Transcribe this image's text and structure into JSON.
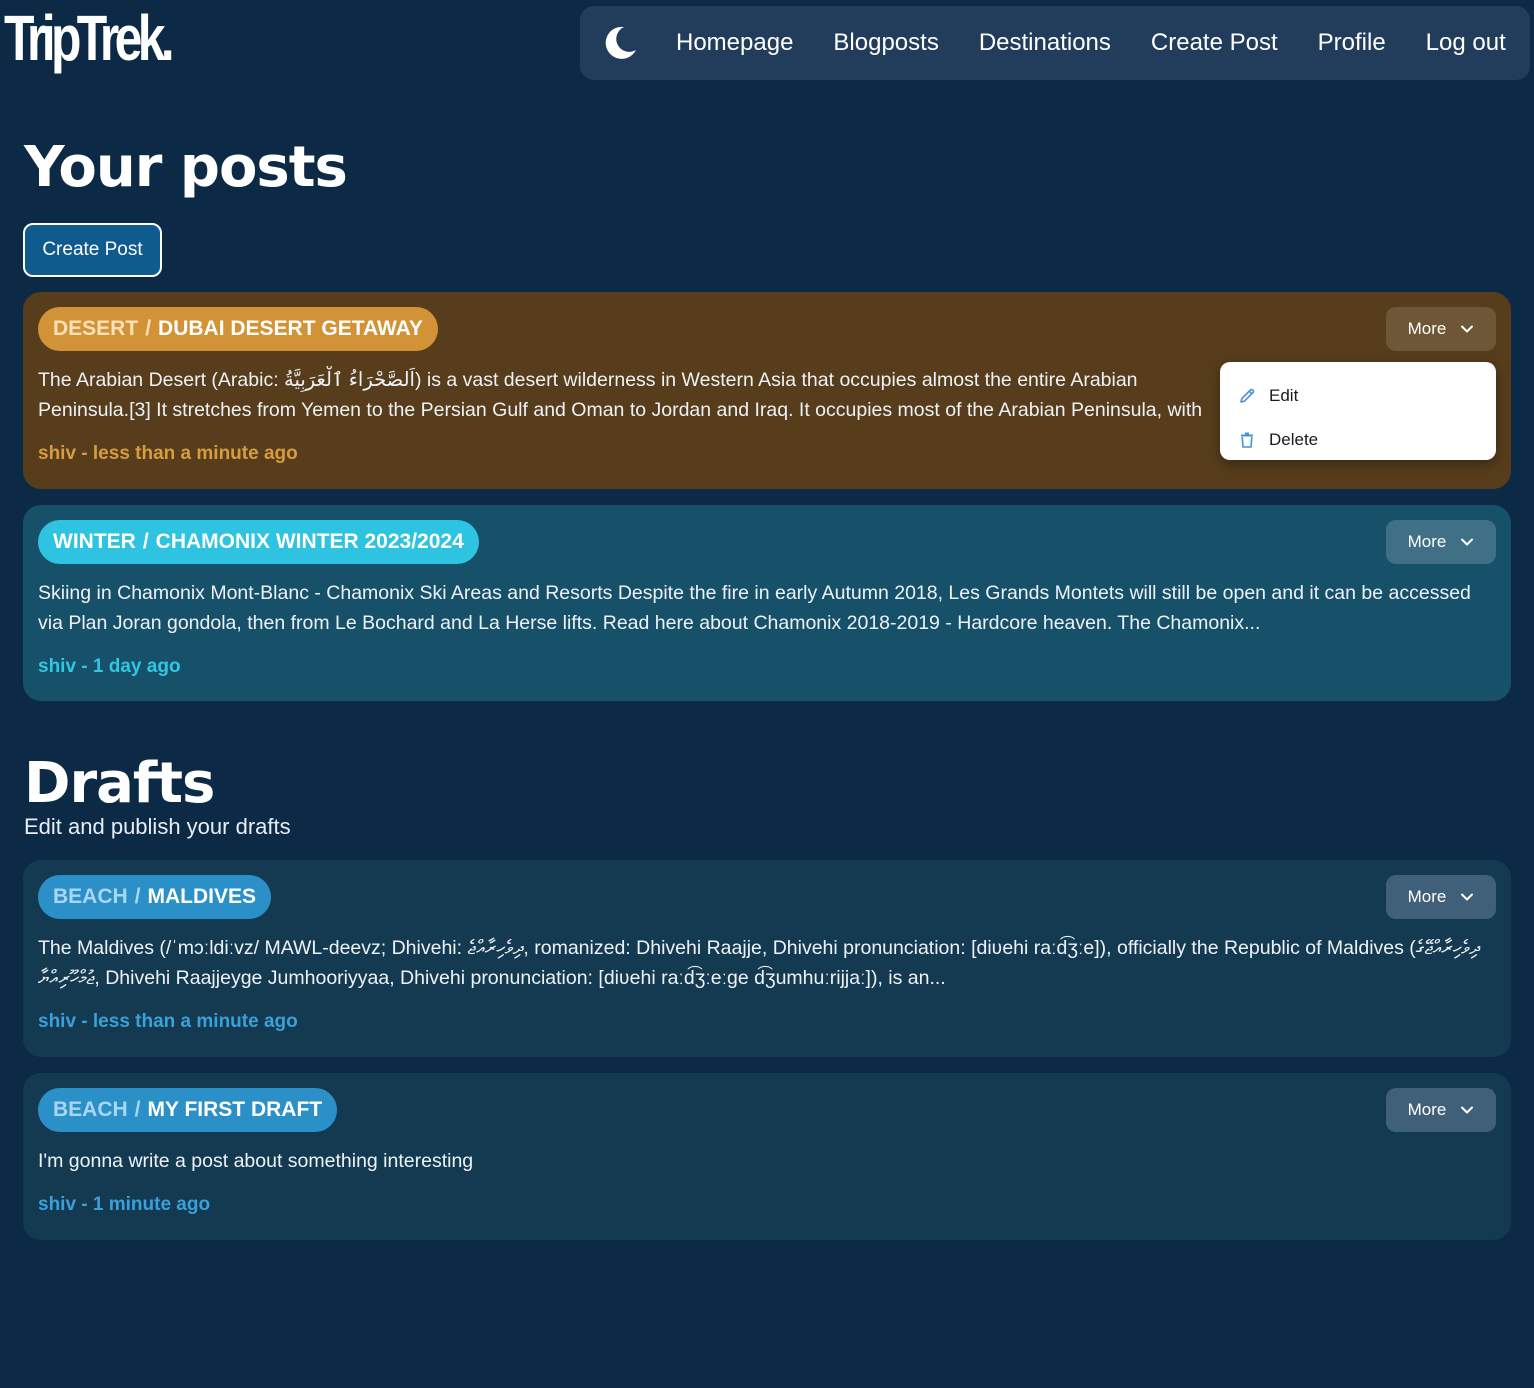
{
  "brand": {
    "logo": "TripTrek."
  },
  "nav": {
    "theme_icon": "moon-icon",
    "links": [
      {
        "label": "Homepage"
      },
      {
        "label": "Blogposts"
      },
      {
        "label": "Destinations"
      },
      {
        "label": "Create Post"
      },
      {
        "label": "Profile"
      },
      {
        "label": "Log out"
      }
    ]
  },
  "posts_section": {
    "title": "Your posts",
    "create_button": "Create Post",
    "posts": [
      {
        "category": "DESERT",
        "separator": "/",
        "title": "DUBAI DESERT GETAWAY",
        "excerpt": "The Arabian Desert (Arabic: اَلصَّحْرَاءُ ٱلْعَرَبِيَّةُ) is a vast desert wilderness in Western Asia that occupies almost the entire Arabian Peninsula.[3] It stretches from Yemen to the Persian Gulf and Oman to Jordan and Iraq. It occupies most of the Arabian Peninsula, with an area of 2,330,000...",
        "meta": "shiv - less than a minute ago",
        "more_label": "More"
      },
      {
        "category": "WINTER",
        "separator": "/",
        "title": "CHAMONIX WINTER 2023/2024",
        "excerpt": "Skiing in Chamonix Mont-Blanc - Chamonix Ski Areas and Resorts Despite the fire in early Autumn 2018, Les Grands Montets will still be open and it can be accessed via Plan Joran gondola, then from Le Bochard and La Herse lifts. Read here about Chamonix 2018-2019 - Hardcore heaven. The Chamonix...",
        "meta": "shiv - 1 day ago",
        "more_label": "More"
      }
    ]
  },
  "dropdown": {
    "items": [
      {
        "label": "Edit",
        "icon": "pencil-icon"
      },
      {
        "label": "Delete",
        "icon": "trash-icon"
      }
    ]
  },
  "drafts_section": {
    "title": "Drafts",
    "subtitle": "Edit and publish your drafts",
    "drafts": [
      {
        "category": "BEACH",
        "separator": "/",
        "title": "MALDIVES",
        "excerpt": "The Maldives (/ˈmɔːldiːvz/ MAWL-deevz; Dhivehi: ދިވެހިރާއްޖެ, romanized: Dhivehi Raajje, Dhivehi pronunciation: [diʋehi raːd͡ʒːe]), officially the Republic of Maldives (ދިވެހިރާއްޖޭގެ ޖުމްހޫރިއްޔާ, Dhivehi Raajjeyge Jumhooriyyaa, Dhivehi pronunciation: [diʋehi raːd͡ʒːeːge d͡ʒumhuːrijjaː]), is an...",
        "meta": "shiv - less than a minute ago",
        "more_label": "More"
      },
      {
        "category": "BEACH",
        "separator": "/",
        "title": "MY FIRST DRAFT",
        "excerpt": "I'm gonna write a post about something interesting",
        "meta": "shiv - 1 minute ago",
        "more_label": "More"
      }
    ]
  },
  "colors": {
    "background": "#0c2a45",
    "navbar": "#223d5c",
    "desert_card": "#573d1c",
    "desert_accent": "#d29336",
    "winter_card": "#165169",
    "winter_accent": "#2ec3e0",
    "draft_card": "#143a52",
    "beach_accent": "#2b90c8"
  }
}
